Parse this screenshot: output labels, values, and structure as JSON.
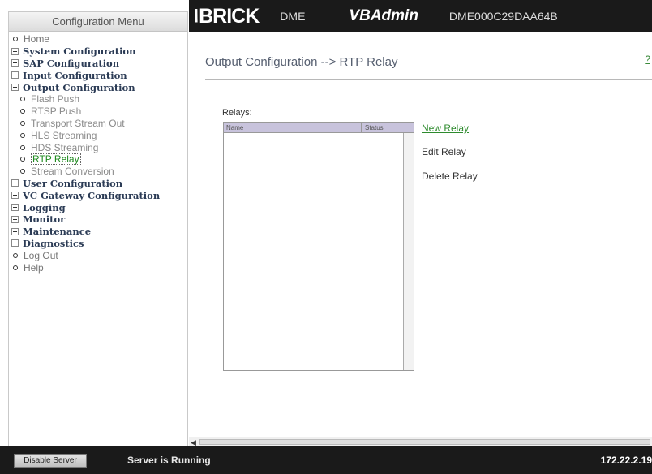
{
  "sidebar": {
    "title": "Configuration Menu",
    "items": [
      {
        "label": "Home",
        "kind": "top",
        "icon": "bullet-icon"
      },
      {
        "label": "System Configuration",
        "kind": "bold",
        "icon": "expand-plus-icon"
      },
      {
        "label": "SAP Configuration",
        "kind": "bold",
        "icon": "expand-plus-icon"
      },
      {
        "label": "Input Configuration",
        "kind": "bold",
        "icon": "expand-plus-icon"
      },
      {
        "label": "Output Configuration",
        "kind": "bold",
        "icon": "collapse-minus-icon"
      },
      {
        "label": "Flash Push",
        "kind": "sub",
        "icon": "bullet-icon"
      },
      {
        "label": "RTSP Push",
        "kind": "sub",
        "icon": "bullet-icon"
      },
      {
        "label": "Transport Stream Out",
        "kind": "sub",
        "icon": "bullet-icon"
      },
      {
        "label": "HLS Streaming",
        "kind": "sub",
        "icon": "bullet-icon"
      },
      {
        "label": "HDS Streaming",
        "kind": "sub",
        "icon": "bullet-icon"
      },
      {
        "label": "RTP Relay",
        "kind": "sub-active",
        "icon": "bullet-icon"
      },
      {
        "label": "Stream Conversion",
        "kind": "sub",
        "icon": "bullet-icon"
      },
      {
        "label": "User Configuration",
        "kind": "bold",
        "icon": "expand-plus-icon"
      },
      {
        "label": "VC Gateway Configuration",
        "kind": "bold",
        "icon": "expand-plus-icon"
      },
      {
        "label": "Logging",
        "kind": "bold",
        "icon": "expand-plus-icon"
      },
      {
        "label": "Monitor",
        "kind": "bold",
        "icon": "expand-plus-icon"
      },
      {
        "label": "Maintenance",
        "kind": "bold",
        "icon": "expand-plus-icon"
      },
      {
        "label": "Diagnostics",
        "kind": "bold",
        "icon": "expand-plus-icon"
      },
      {
        "label": "Log Out",
        "kind": "top",
        "icon": "bullet-icon"
      },
      {
        "label": "Help",
        "kind": "top",
        "icon": "bullet-icon"
      }
    ]
  },
  "header": {
    "logo": "BRICK",
    "product": "DME",
    "app_name": "VBAdmin",
    "device_id": "DME000C29DAA64B"
  },
  "main": {
    "page_title": "Output Configuration --> RTP Relay",
    "help_link": "?",
    "relays_label": "Relays:",
    "table": {
      "columns": [
        "Name",
        "Status"
      ],
      "rows": []
    },
    "actions": {
      "new": "New Relay",
      "edit": "Edit Relay",
      "delete": "Delete Relay"
    },
    "scroll_arrow": "◀"
  },
  "footer": {
    "disable_button": "Disable Server",
    "status": "Server is Running",
    "ip": "172.22.2.19"
  },
  "colors": {
    "header_bg": "#1a1a1a",
    "link_green": "#2e8b2e",
    "table_header": "#c8c3dc",
    "menu_bold": "#2b3b55"
  }
}
